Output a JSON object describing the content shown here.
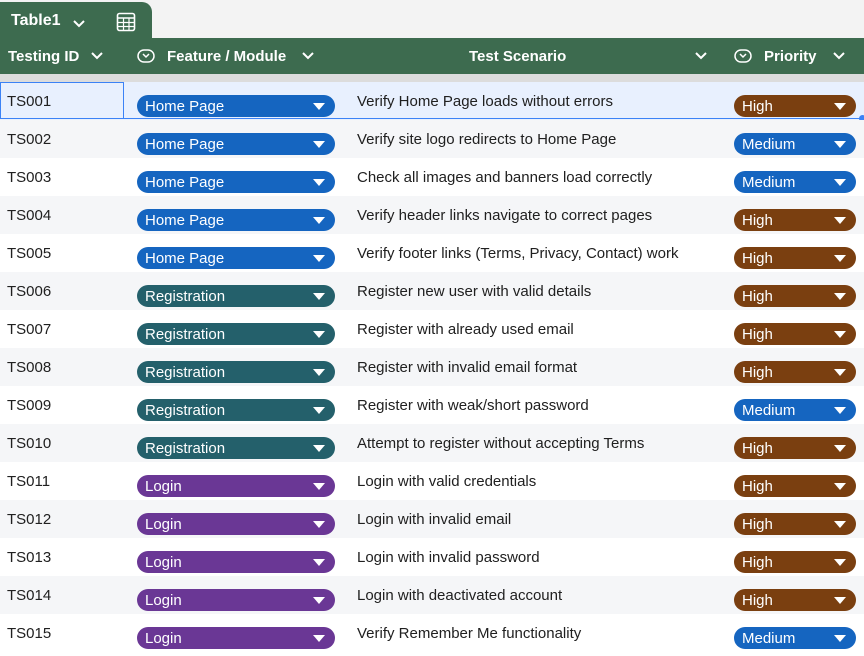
{
  "table_tab": {
    "name": "Table1"
  },
  "columns": {
    "id": "Testing ID",
    "feature": "Feature / Module",
    "scenario": "Test Scenario",
    "priority": "Priority"
  },
  "colors": {
    "header_bg": "#3d6b4f",
    "home_page": "#1565c0",
    "registration": "#24606b",
    "login": "#6a3795",
    "high": "#7a3f10",
    "medium": "#1565c0"
  },
  "rows": [
    {
      "id": "TS001",
      "feature": "Home Page",
      "scenario": "Verify Home Page loads without errors",
      "priority": "High"
    },
    {
      "id": "TS002",
      "feature": "Home Page",
      "scenario": "Verify site logo redirects to Home Page",
      "priority": "Medium"
    },
    {
      "id": "TS003",
      "feature": "Home Page",
      "scenario": "Check all images and banners load correctly",
      "priority": "Medium"
    },
    {
      "id": "TS004",
      "feature": "Home Page",
      "scenario": "Verify header links navigate to correct pages",
      "priority": "High"
    },
    {
      "id": "TS005",
      "feature": "Home Page",
      "scenario": "Verify footer links (Terms, Privacy, Contact) work",
      "priority": "High"
    },
    {
      "id": "TS006",
      "feature": "Registration",
      "scenario": "Register new user with valid details",
      "priority": "High"
    },
    {
      "id": "TS007",
      "feature": "Registration",
      "scenario": "Register with already used email",
      "priority": "High"
    },
    {
      "id": "TS008",
      "feature": "Registration",
      "scenario": "Register with invalid email format",
      "priority": "High"
    },
    {
      "id": "TS009",
      "feature": "Registration",
      "scenario": "Register with weak/short password",
      "priority": "Medium"
    },
    {
      "id": "TS010",
      "feature": "Registration",
      "scenario": "Attempt to register without accepting Terms",
      "priority": "High"
    },
    {
      "id": "TS011",
      "feature": "Login",
      "scenario": "Login with valid credentials",
      "priority": "High"
    },
    {
      "id": "TS012",
      "feature": "Login",
      "scenario": "Login with invalid email",
      "priority": "High"
    },
    {
      "id": "TS013",
      "feature": "Login",
      "scenario": "Login with invalid password",
      "priority": "High"
    },
    {
      "id": "TS014",
      "feature": "Login",
      "scenario": "Login with deactivated account",
      "priority": "High"
    },
    {
      "id": "TS015",
      "feature": "Login",
      "scenario": "Verify Remember Me functionality",
      "priority": "Medium"
    }
  ]
}
